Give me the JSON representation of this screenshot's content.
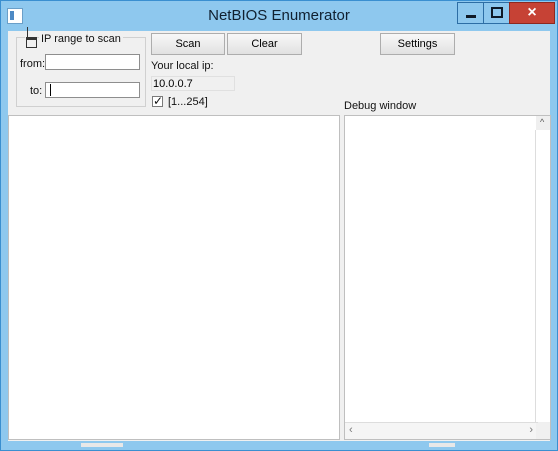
{
  "window": {
    "title": "NetBIOS Enumerator",
    "accent": "#8ec8ee",
    "close_color": "#c64235"
  },
  "icons": {
    "app": "app-icon",
    "network": "network-icon",
    "minimize": "minimize-icon",
    "maximize": "maximize-icon",
    "close": "close-icon"
  },
  "group": {
    "label": "IP range to scan",
    "from_label": "from:",
    "from_value": "",
    "to_label": "to:",
    "to_value": ""
  },
  "toolbar": {
    "scan": "Scan",
    "clear": "Clear",
    "settings": "Settings"
  },
  "local": {
    "label": "Your local ip:",
    "value": "10.0.0.7",
    "range_checked": true,
    "range_label": "[1...254]"
  },
  "debug": {
    "label": "Debug window"
  }
}
